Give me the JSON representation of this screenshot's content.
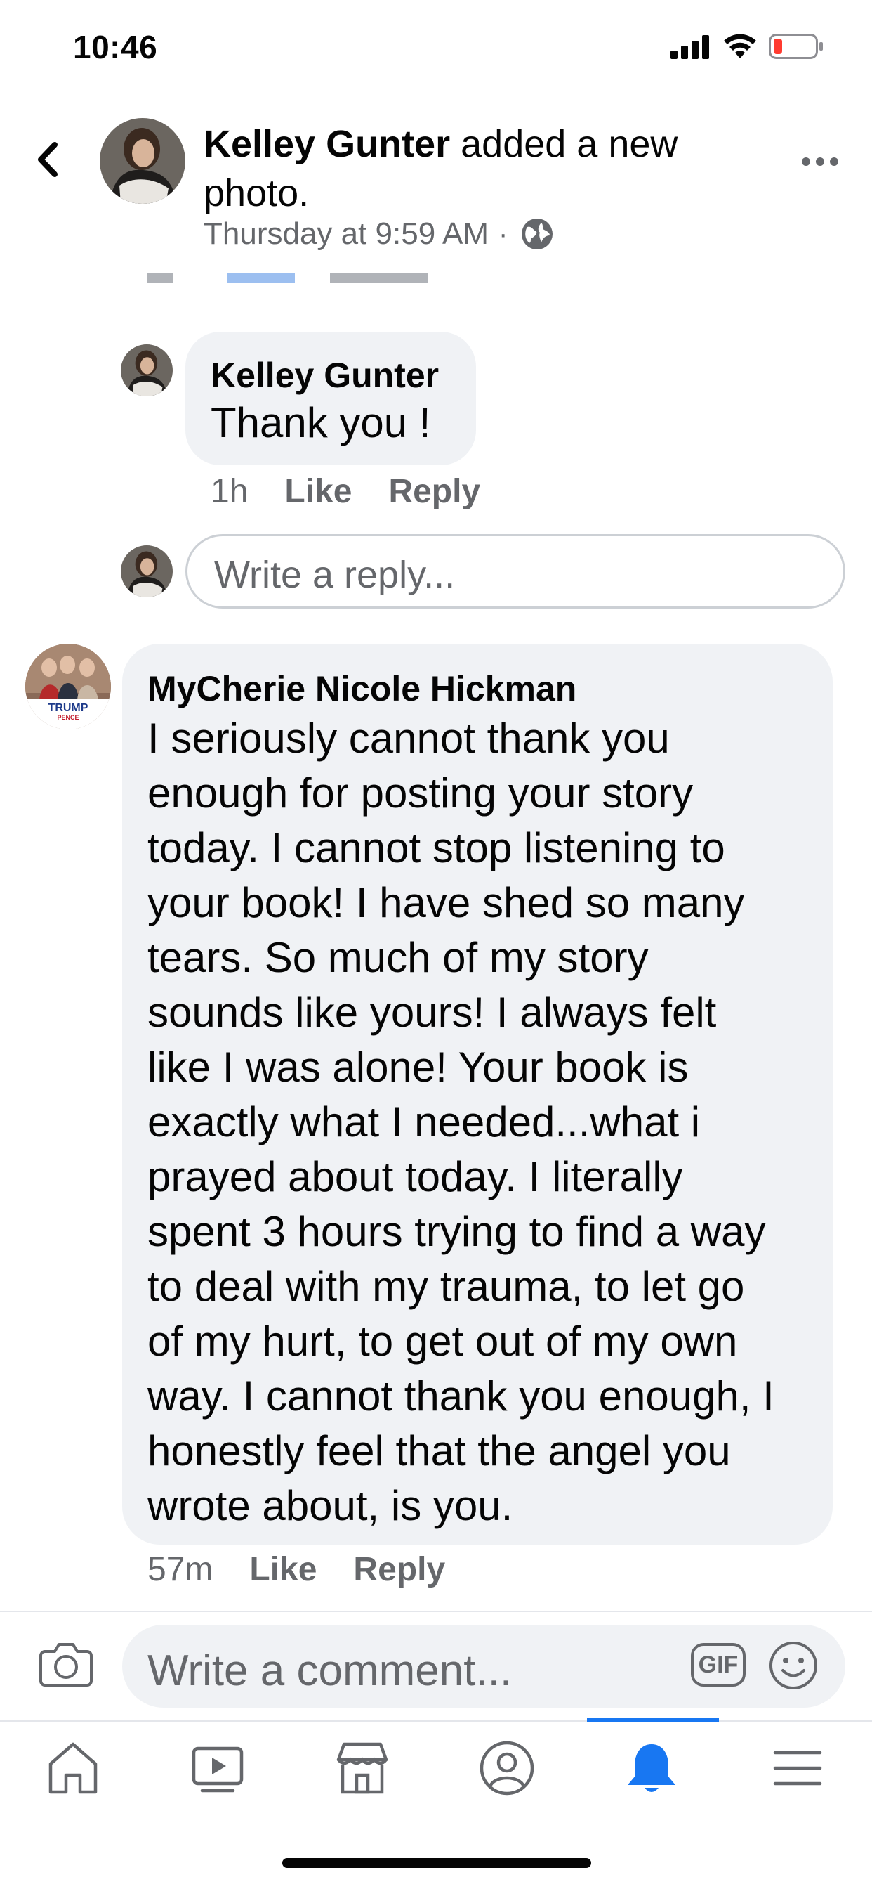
{
  "status_bar": {
    "time": "10:46"
  },
  "post_header": {
    "author": "Kelley Gunter",
    "action": "added a new photo.",
    "timestamp": "Thursday at 9:59 AM",
    "separator": "·",
    "audience_icon": "globe-icon",
    "back_icon": "chevron-left-icon",
    "more_icon": "more-horizontal-icon"
  },
  "reply": {
    "author": "Kelley Gunter",
    "text": "Thank you !",
    "time": "1h",
    "like_label": "Like",
    "reply_label": "Reply"
  },
  "write_reply": {
    "placeholder": "Write a reply..."
  },
  "comment": {
    "author": "MyCherie Nicole Hickman",
    "avatar_badge_line1": "TRUMP",
    "avatar_badge_line2": "PENCE",
    "text": "I seriously cannot thank you\nenough for posting your story\ntoday. I cannot stop listening to\nyour book! I have shed so many\ntears. So much of my story\nsounds like yours! I always felt\nlike I was alone! Your book is\nexactly what I needed...what i\nprayed about today. I literally\nspent 3 hours trying to find a way\nto deal with my trauma, to let go\nof my hurt, to get out of my own\nway. I cannot thank you enough, I\nhonestly feel that the angel you\nwrote about, is you.",
    "time": "57m",
    "like_label": "Like",
    "reply_label": "Reply"
  },
  "composer": {
    "placeholder": "Write a comment...",
    "gif_label": "GIF",
    "camera_icon": "camera-icon",
    "emoji_icon": "emoji-icon"
  },
  "tabs": [
    {
      "name": "home",
      "icon": "home-icon"
    },
    {
      "name": "watch",
      "icon": "video-icon"
    },
    {
      "name": "marketplace",
      "icon": "store-icon"
    },
    {
      "name": "profile",
      "icon": "profile-icon"
    },
    {
      "name": "notifications",
      "icon": "bell-icon",
      "active": true
    },
    {
      "name": "menu",
      "icon": "hamburger-menu-icon"
    }
  ],
  "colors": {
    "accent": "#1877f2",
    "bubble": "#f0f2f5",
    "secondary_text": "#65676b",
    "battery_low": "#ff3b30"
  }
}
